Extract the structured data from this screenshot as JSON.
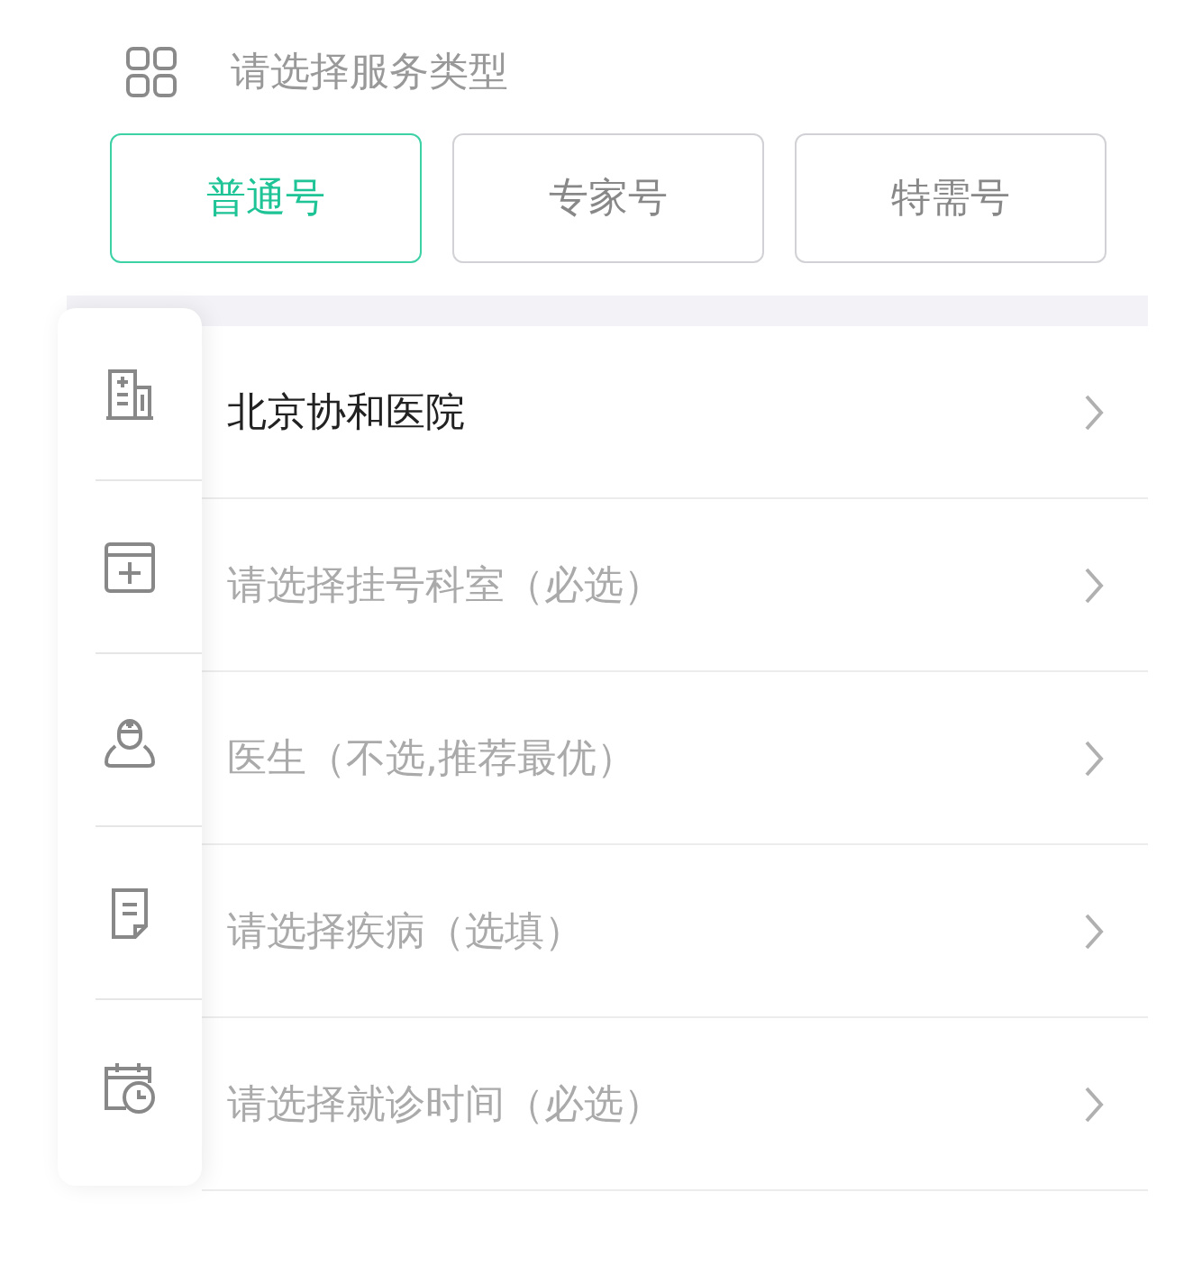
{
  "service_type": {
    "label": "请选择服务类型"
  },
  "types": [
    {
      "label": "普通号",
      "selected": true
    },
    {
      "label": "专家号",
      "selected": false
    },
    {
      "label": "特需号",
      "selected": false
    }
  ],
  "rows": [
    {
      "text": "北京协和医院",
      "filled": true
    },
    {
      "text": "请选择挂号科室（必选）",
      "filled": false
    },
    {
      "text": "医生（不选,推荐最优）",
      "filled": false
    },
    {
      "text": "请选择疾病（选填）",
      "filled": false
    },
    {
      "text": "请选择就诊时间（必选）",
      "filled": false
    }
  ]
}
